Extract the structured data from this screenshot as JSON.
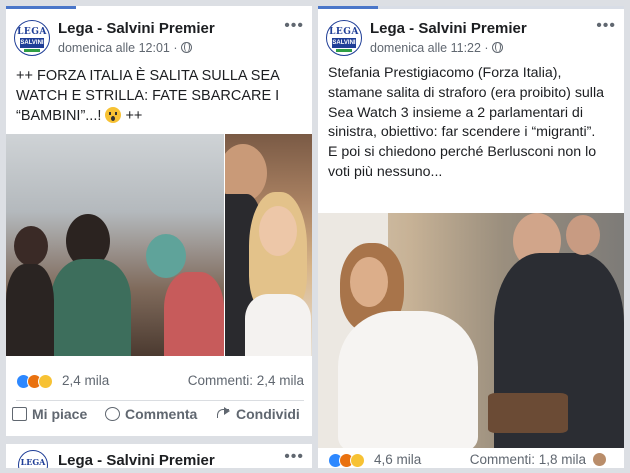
{
  "left_post": {
    "page_name": "Lega - Salvini Premier",
    "avatar_text_top": "LEGA",
    "avatar_text_mid": "SALVINI",
    "timestamp": "domenica alle 12:01 ·",
    "text_before_emoji": "++ FORZA ITALIA È SALITA SULLA SEA WATCH E STRILLA: FATE SBARCARE I “BAMBINI”...!",
    "text_after_emoji": "++",
    "reaction_count": "2,4 mila",
    "comments_count": "Commenti: 2,4 mila",
    "actions": {
      "like": "Mi piace",
      "comment": "Commenta",
      "share": "Condividi"
    },
    "next_post_page_name": "Lega - Salvini Premier",
    "next_post_avatar_text": "LEGA"
  },
  "right_post": {
    "page_name": "Lega - Salvini Premier",
    "avatar_text_top": "LEGA",
    "avatar_text_mid": "SALVINI",
    "timestamp": "domenica alle 11:22 ·",
    "text_line1": "Stefania Prestigiacomo (Forza Italia), stamane salita di straforo (era proibito) sulla Sea Watch 3 insieme a 2 parlamentari di sinistra, obiettivo: far scendere i “migranti”.",
    "text_line2": "E poi si chiedono perché Berlusconi non lo voti più nessuno...",
    "reaction_count": "4,6 mila",
    "comments_count": "Commenti: 1,8 mila"
  },
  "icons": {
    "more": "more-options-icon",
    "globe": "globe-icon",
    "like": "thumbs-up-icon",
    "comment": "comment-bubble-icon",
    "share": "share-arrow-icon",
    "emoji": "scream-emoji-icon"
  },
  "colors": {
    "facebook_blue": "#4a76c9",
    "lega_blue": "#1f3e97",
    "text_gray": "#606770"
  }
}
